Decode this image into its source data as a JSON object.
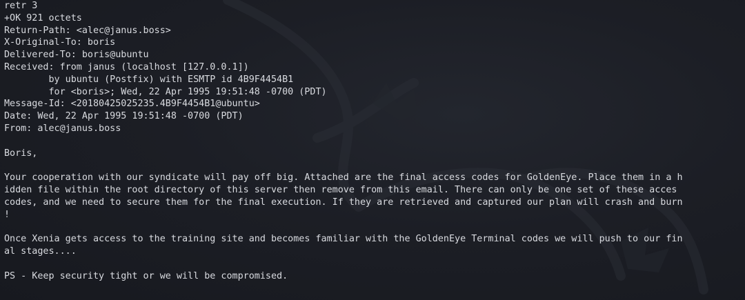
{
  "terminal": {
    "lines": [
      "retr 3",
      "+OK 921 octets",
      "Return-Path: <alec@janus.boss>",
      "X-Original-To: boris",
      "Delivered-To: boris@ubuntu",
      "Received: from janus (localhost [127.0.0.1])",
      "        by ubuntu (Postfix) with ESMTP id 4B9F4454B1",
      "        for <boris>; Wed, 22 Apr 1995 19:51:48 -0700 (PDT)",
      "Message-Id: <20180425025235.4B9F4454B1@ubuntu>",
      "Date: Wed, 22 Apr 1995 19:51:48 -0700 (PDT)",
      "From: alec@janus.boss",
      "",
      "Boris,",
      "",
      "Your cooperation with our syndicate will pay off big. Attached are the final access codes for GoldenEye. Place them in a h",
      "idden file within the root directory of this server then remove from this email. There can only be one set of these acces",
      "codes, and we need to secure them for the final execution. If they are retrieved and captured our plan will crash and burn",
      "!",
      "",
      "Once Xenia gets access to the training site and becomes familiar with the GoldenEye Terminal codes we will push to our fin",
      "al stages....",
      "",
      "PS - Keep security tight or we will be compromised.",
      "",
      "."
    ]
  },
  "colors": {
    "background": "#1b1d24",
    "text": "#d9dbe0"
  },
  "icons": {
    "watermark": "kali-dragon-icon"
  }
}
